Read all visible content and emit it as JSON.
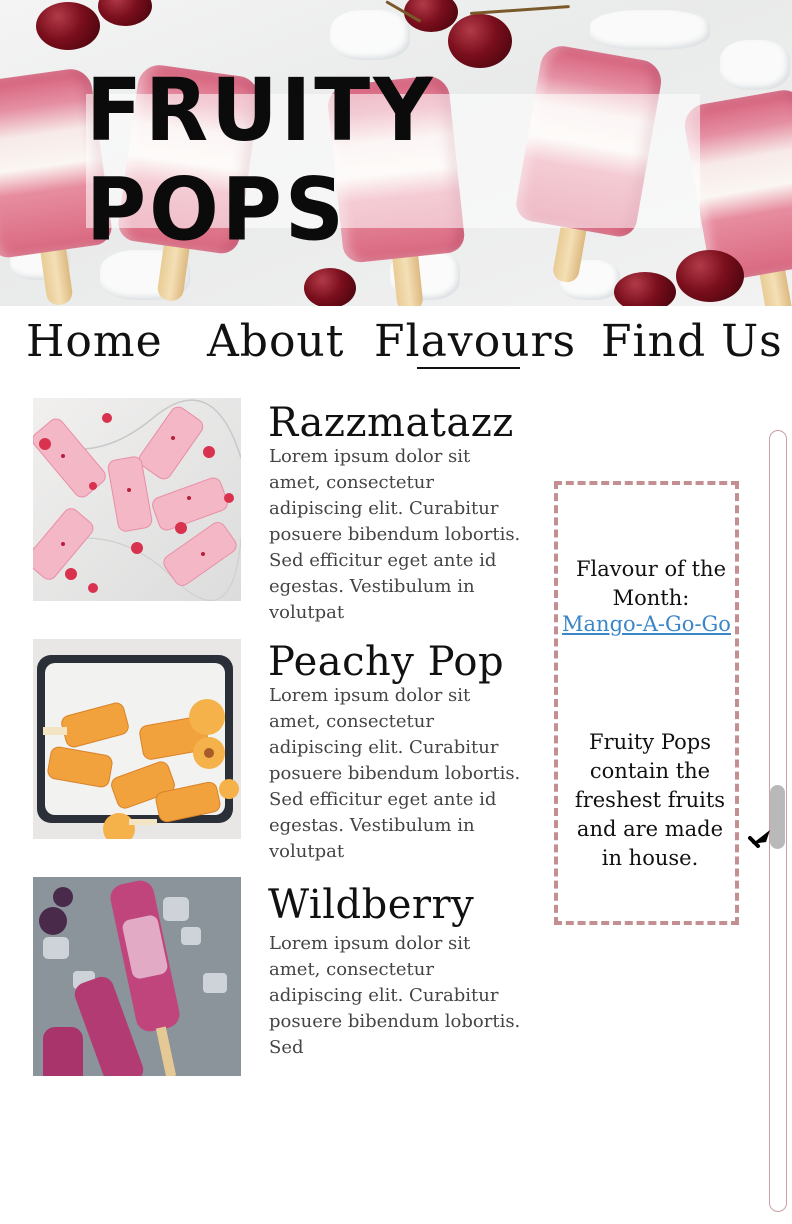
{
  "header": {
    "title": "FRUITY POPS"
  },
  "nav": {
    "items": [
      {
        "label": "Home"
      },
      {
        "label": "About"
      },
      {
        "label": "Flavours",
        "active": true
      },
      {
        "label": "Find Us"
      }
    ]
  },
  "flavours": [
    {
      "name": "Razzmatazz",
      "description": "Lorem ipsum dolor sit amet, consectetur adipiscing elit. Curabitur posuere bibendum lobortis. Sed efficitur eget ante id egestas. Vestibulum in volutpat",
      "image_icon": "raspberry-popsicles-image"
    },
    {
      "name": "Peachy Pop",
      "description": "Lorem ipsum dolor sit amet, consectetur adipiscing elit. Curabitur posuere bibendum lobortis. Sed efficitur eget ante id egestas. Vestibulum in volutpat",
      "image_icon": "peach-popsicles-image"
    },
    {
      "name": "Wildberry",
      "description": "Lorem ipsum dolor sit amet, consectetur adipiscing elit. Curabitur posuere bibendum lobortis. Sed",
      "image_icon": "wildberry-popsicles-image"
    }
  ],
  "sidebar": {
    "label": "Flavour of the Month:",
    "link_text": "Mango-A-Go-Go",
    "note": "Fruity Pops contain the freshest fruits and are made in house."
  },
  "colors": {
    "accent_border": "#c48f91",
    "link": "#3a86c8",
    "text": "#111111"
  },
  "scrollbar": {
    "position": 0.48
  }
}
